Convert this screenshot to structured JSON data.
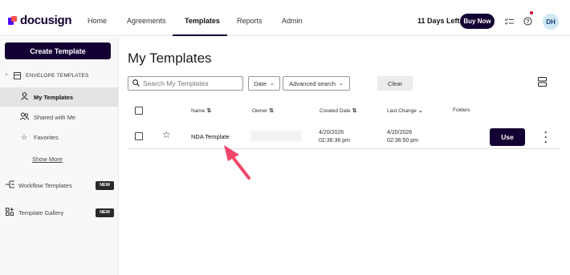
{
  "brand": {
    "name": "docusign"
  },
  "nav": {
    "items": [
      "Home",
      "Agreements",
      "Templates",
      "Reports",
      "Admin"
    ],
    "active": "Templates",
    "trial": "11 Days Left",
    "buy_now": "Buy Now",
    "avatar_initials": "DH",
    "icons": [
      "checklist-icon",
      "help-icon"
    ]
  },
  "sidebar": {
    "create_button": "Create Template",
    "section_label": "ENVELOPE TEMPLATES",
    "items": [
      {
        "label": "My Templates",
        "icon": "person-icon",
        "active": true
      },
      {
        "label": "Shared with Me",
        "icon": "people-icon",
        "active": false
      },
      {
        "label": "Favorites",
        "icon": "star-icon",
        "active": false
      }
    ],
    "show_more": "Show More",
    "extra": [
      {
        "label": "Workflow Templates",
        "icon": "workflow-icon",
        "badge": "NEW"
      },
      {
        "label": "Template Gallery",
        "icon": "gallery-icon",
        "badge": "NEW"
      }
    ]
  },
  "main": {
    "title": "My Templates",
    "search_placeholder": "Search My Templates",
    "date_filter": "Date",
    "advanced_search": "Advanced search",
    "clear": "Clear",
    "columns": [
      "Name",
      "Owner",
      "Created Date",
      "Last Change",
      "Folders"
    ],
    "rows": [
      {
        "name": "NDA Template",
        "owner": "",
        "created_date": "4/20/2026",
        "created_time": "02:36:36 pm",
        "last_change_date": "4/20/2026",
        "last_change_time": "02:36:50 pm",
        "folders": "",
        "action": "Use"
      }
    ]
  },
  "colors": {
    "primary": "#130032",
    "brand_purple": "#4c00ff",
    "brand_red": "#ff5252",
    "annotation_arrow": "#f0476a",
    "notification_dot": "#d6002f",
    "avatar_bg": "#cfe8f3"
  }
}
